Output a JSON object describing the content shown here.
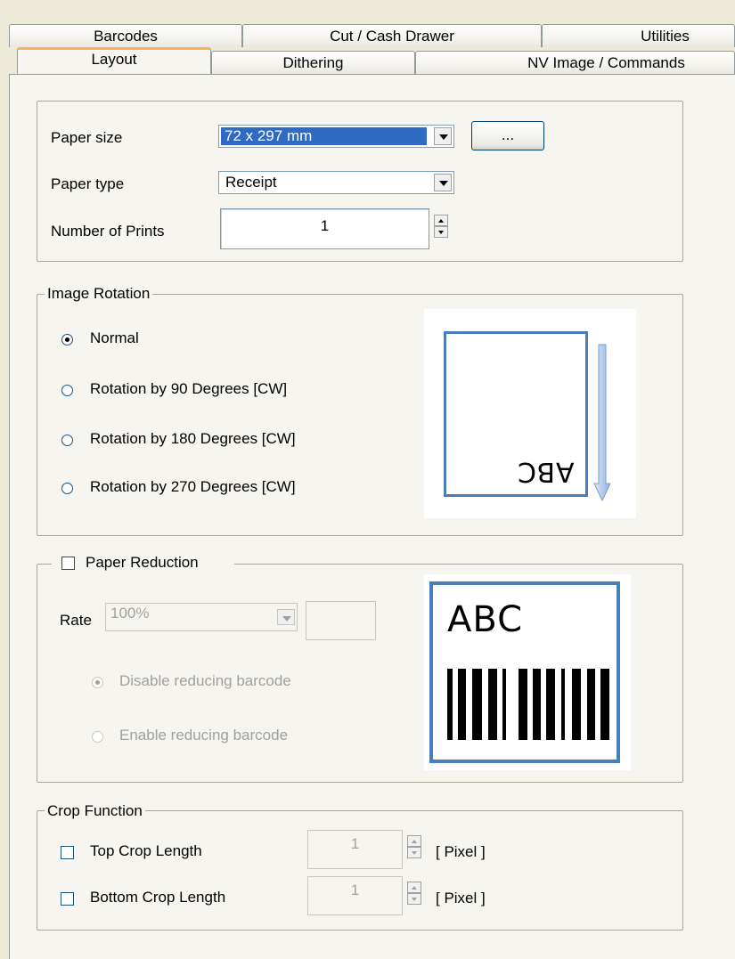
{
  "tabs": {
    "row1": [
      "Barcodes",
      "Cut / Cash Drawer",
      "Utilities"
    ],
    "row2": [
      "Layout",
      "Dithering",
      "NV Image / Commands"
    ]
  },
  "paper": {
    "paper_size_label": "Paper size",
    "paper_size_value": "72 x 297 mm",
    "browse_label": "...",
    "paper_type_label": "Paper type",
    "paper_type_value": "Receipt",
    "num_prints_label": "Number of Prints",
    "num_prints_value": "1"
  },
  "rotation": {
    "title": "Image Rotation",
    "options": [
      "Normal",
      "Rotation by 90 Degrees [CW]",
      "Rotation by 180 Degrees [CW]",
      "Rotation by 270 Degrees [CW]"
    ],
    "selected": 0,
    "preview_text": "ABC"
  },
  "reduction": {
    "title": "Paper Reduction",
    "rate_label": "Rate",
    "rate_value": "100%",
    "options": [
      "Disable reducing barcode",
      "Enable reducing barcode"
    ],
    "selected": 0,
    "preview_text": "ABC"
  },
  "crop": {
    "title": "Crop Function",
    "top_label": "Top Crop Length",
    "top_value": "1",
    "bottom_label": "Bottom Crop Length",
    "bottom_value": "1",
    "unit": "[ Pixel ]"
  },
  "colors": {
    "accent": "#316ac5",
    "tab_highlight": "#f8b35a",
    "preview_border": "#4a7ebb"
  }
}
